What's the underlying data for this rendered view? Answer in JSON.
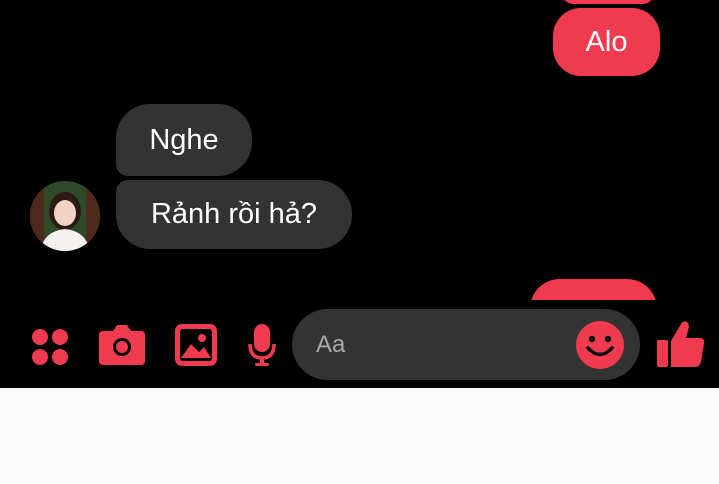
{
  "colors": {
    "accent": "#f03a4f",
    "incoming_bubble": "#333334",
    "background": "#000000",
    "text": "#ffffff",
    "placeholder": "#a8a8a8",
    "bottom_area": "#fafafa"
  },
  "messages": [
    {
      "direction": "outgoing",
      "text": "Alo"
    },
    {
      "direction": "incoming",
      "text": "Nghe"
    },
    {
      "direction": "incoming",
      "text": "Rảnh rồi hả?"
    }
  ],
  "composer": {
    "placeholder": "Aa",
    "icons": [
      "apps-icon",
      "camera-icon",
      "image-icon",
      "mic-icon",
      "emoji-icon",
      "thumbs-up-icon"
    ]
  }
}
